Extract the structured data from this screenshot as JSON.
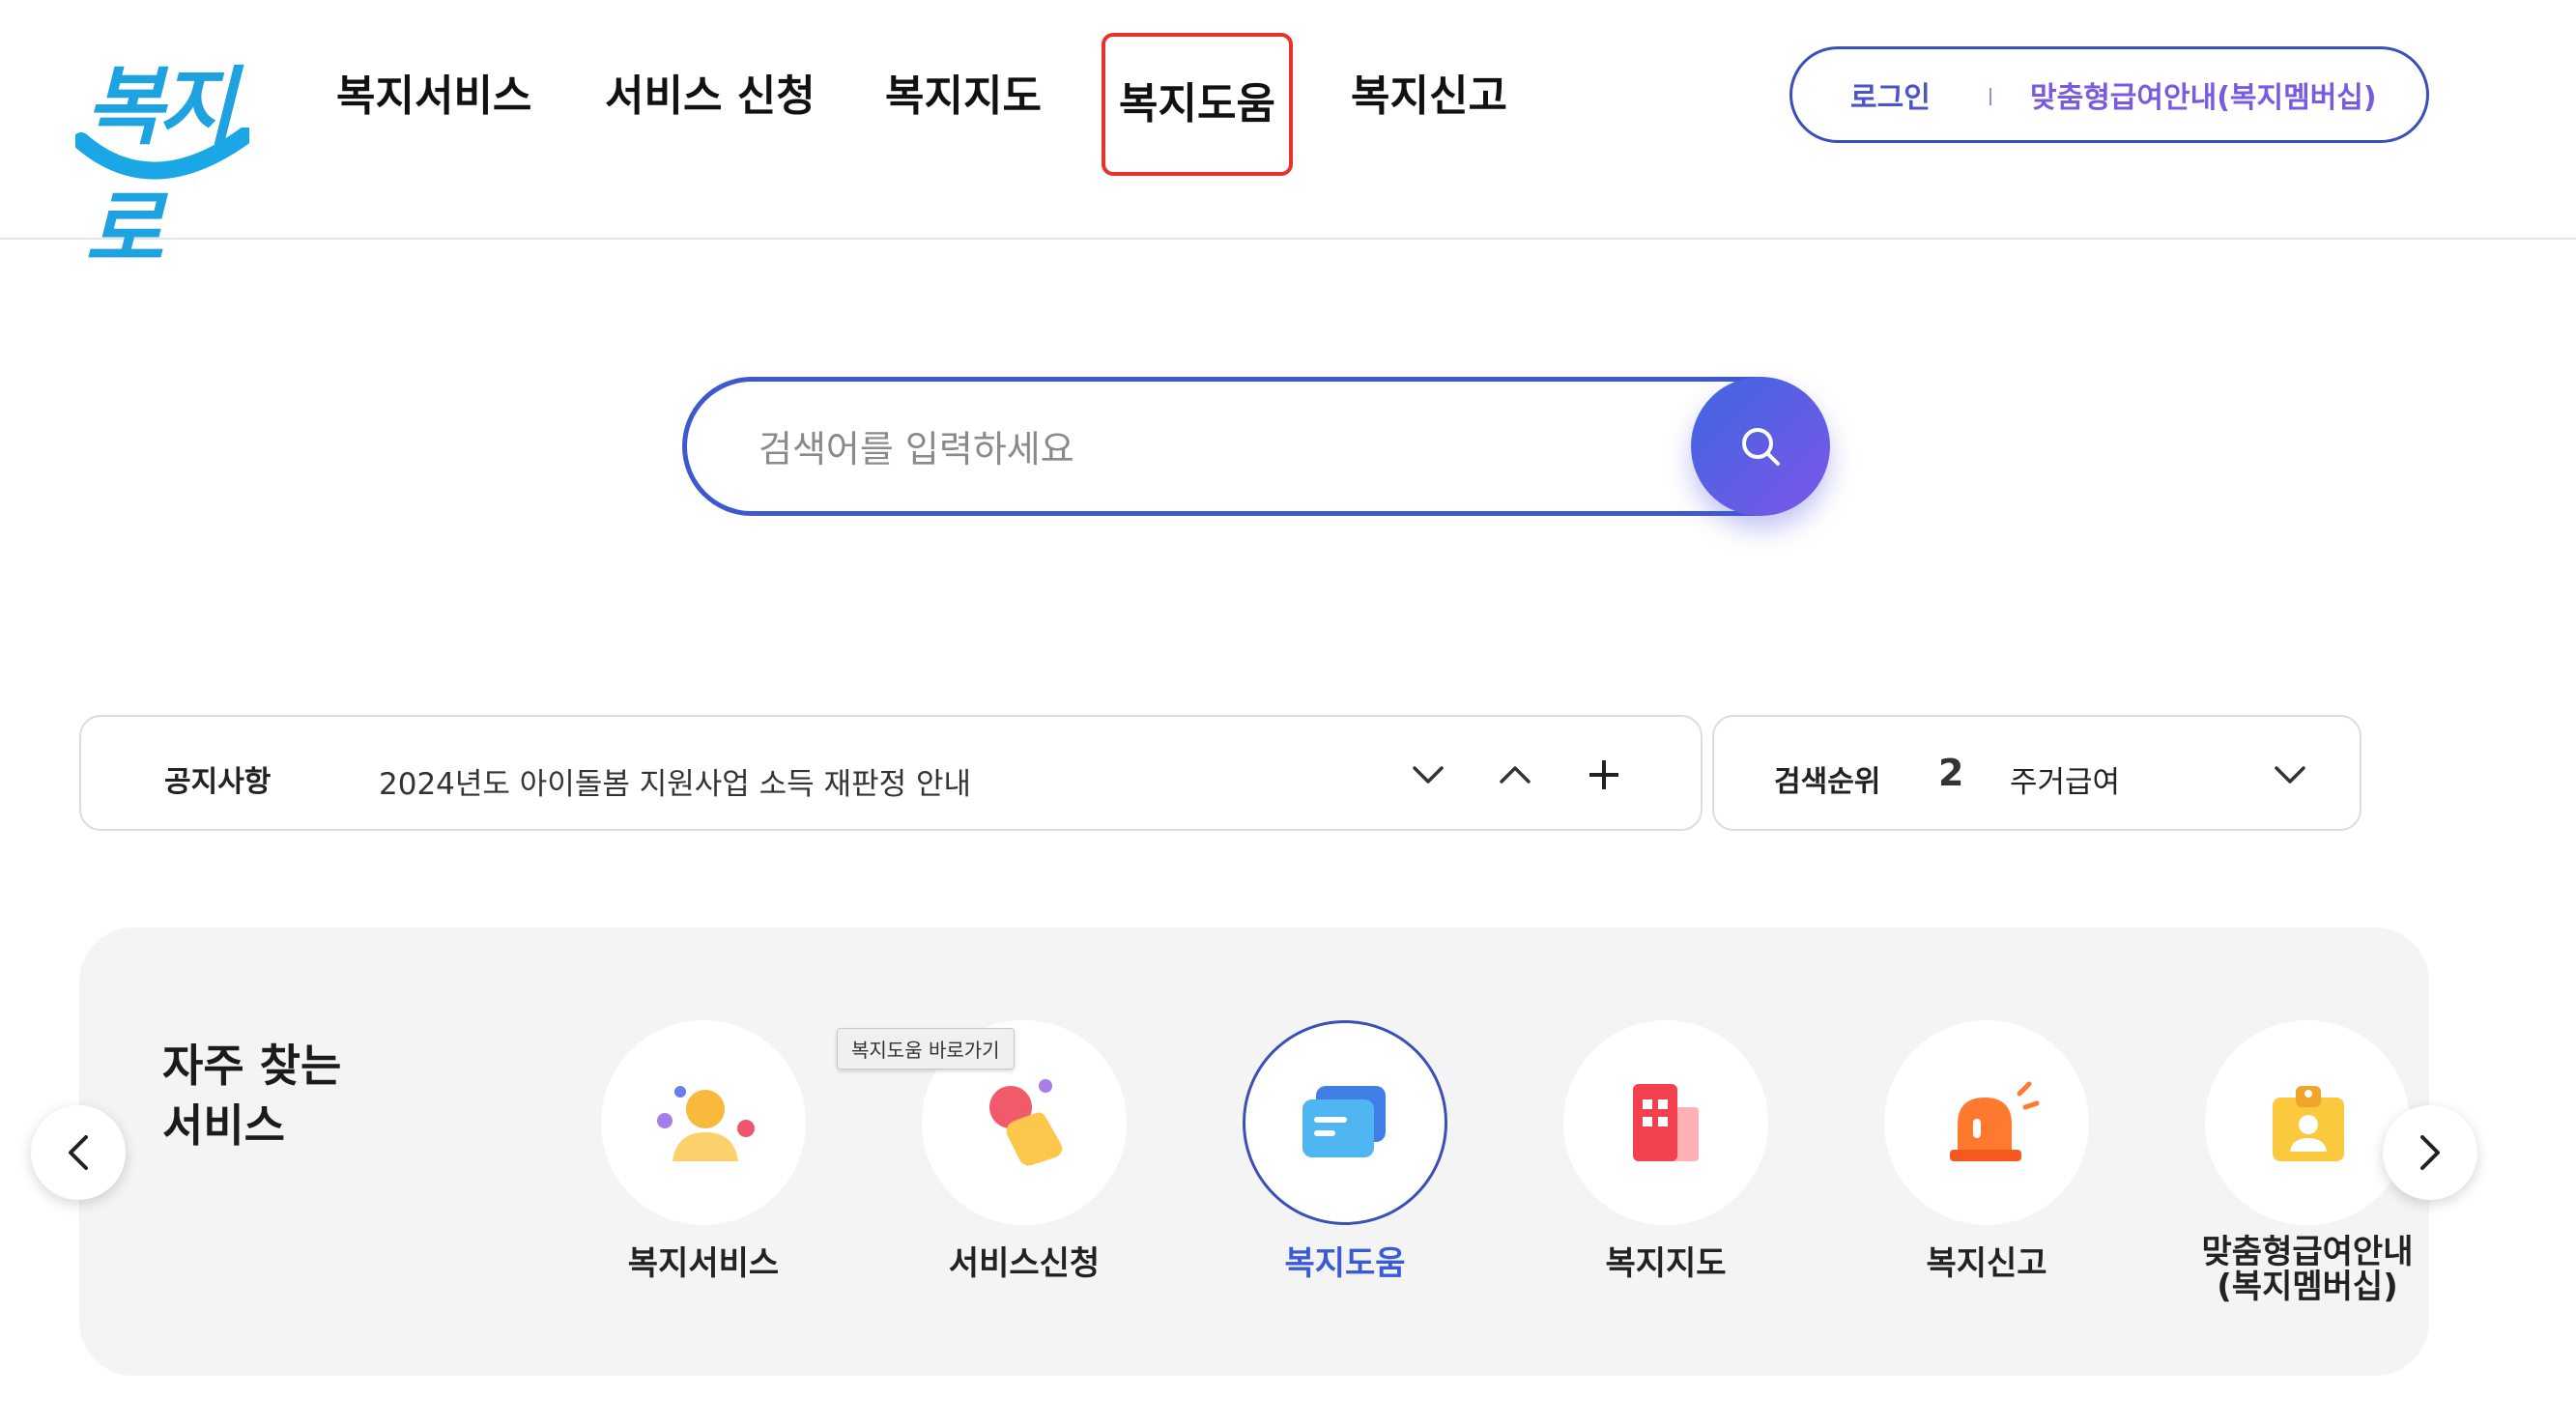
{
  "logo": {
    "text": "복지로"
  },
  "gnb": [
    {
      "label": "복지서비스"
    },
    {
      "label": "서비스 신청"
    },
    {
      "label": "복지지도"
    },
    {
      "label": "복지도움"
    },
    {
      "label": "복지신고"
    }
  ],
  "util": {
    "login": "로그인",
    "guide": "맞춤형급여안내(복지멤버십)"
  },
  "search": {
    "placeholder": "검색어를 입력하세요",
    "value": ""
  },
  "notice": {
    "label": "공지사항",
    "text": "2024년도 아이돌봄 지원사업 소득 재판정 안내"
  },
  "rank": {
    "label": "검색순위",
    "number": "2",
    "text": "주거급여"
  },
  "quick": {
    "title_line1": "자주 찾는",
    "title_line2": "서비스",
    "tooltip": "복지도움 바로가기",
    "items": [
      {
        "label": "복지서비스"
      },
      {
        "label": "서비스신청"
      },
      {
        "label": "복지도움"
      },
      {
        "label": "복지지도"
      },
      {
        "label": "복지신고"
      },
      {
        "label_line1": "맞춤형급여안내",
        "label_line2": "(복지멤버십)"
      }
    ]
  },
  "colors": {
    "accent": "#3b4fb8",
    "highlight": "#e8332a",
    "active_label": "#3b5bd6",
    "quick_bg": "#f4f4f4"
  }
}
